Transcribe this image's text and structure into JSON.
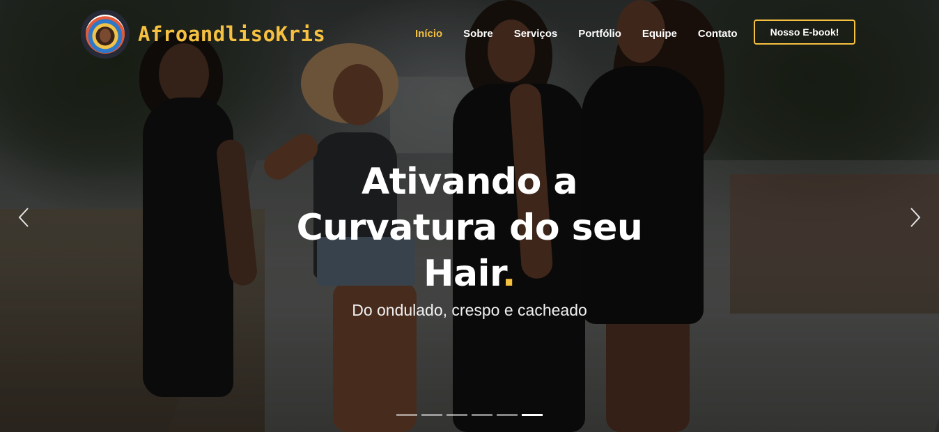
{
  "brand": {
    "name": "AfroandlisoKris",
    "accent_color": "#f6c041",
    "avatar_icon": "profile-avatar-icon"
  },
  "nav": {
    "items": [
      {
        "label": "Início",
        "active": true
      },
      {
        "label": "Sobre",
        "active": false
      },
      {
        "label": "Serviços",
        "active": false
      },
      {
        "label": "Portfólio",
        "active": false
      },
      {
        "label": "Equipe",
        "active": false
      },
      {
        "label": "Contato",
        "active": false
      }
    ],
    "cta_label": "Nosso E-book!"
  },
  "hero": {
    "title_lines": [
      "Ativando a",
      "Curvatura do seu",
      "Hair"
    ],
    "title_dot": ".",
    "subtitle": "Do ondulado, crespo e cacheado"
  },
  "carousel": {
    "prev_icon": "chevron-left-icon",
    "next_icon": "chevron-right-icon",
    "slide_count": 6,
    "active_slide": 6
  }
}
